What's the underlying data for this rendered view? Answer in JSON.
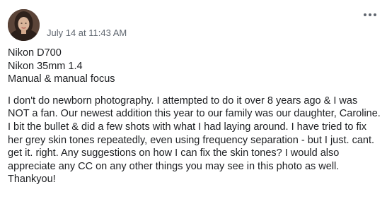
{
  "post": {
    "timestamp": "July 14 at 11:43 AM",
    "gear_lines": [
      "Nikon D700",
      "Nikon 35mm 1.4",
      "Manual & manual focus"
    ],
    "description": "I don't do newborn photography. I attempted to do it over 8 years ago & I was NOT a fan. Our newest addition this year to our family was our daughter, Caroline. I bit the bullet & did a few shots with what I had laying around. I have tried to fix her grey skin tones repeatedly, even using frequency separation - but I just. cant. get it. right. Any suggestions on how I can fix the skin tones? I would also appreciate any CC on any other things you may see in this photo as well. Thankyou!"
  },
  "icons": {
    "avatar": "profile-photo",
    "more": "more-options-icon"
  },
  "colors": {
    "text": "#1c1e21",
    "secondary_text": "#606770",
    "background": "#ffffff"
  }
}
